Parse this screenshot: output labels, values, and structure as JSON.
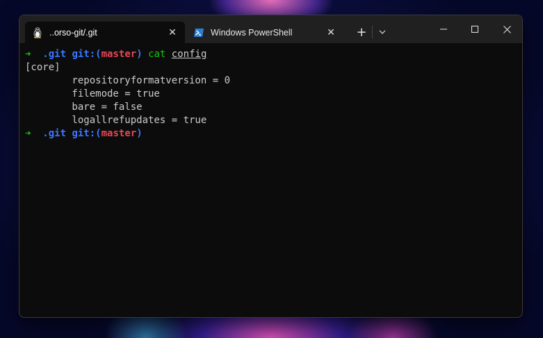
{
  "window": {
    "tabs": [
      {
        "title": "..orso-git/.git",
        "icon": "linux-penguin-icon",
        "active": true
      },
      {
        "title": "Windows PowerShell",
        "icon": "powershell-icon",
        "active": false
      }
    ],
    "new_tab_label": "+",
    "dropdown_label": "⌄"
  },
  "terminal": {
    "prompt": {
      "arrow": "➜",
      "dir": ".git",
      "git_prefix": "git:(",
      "branch": "master",
      "git_suffix": ")"
    },
    "command": "cat",
    "argument": "config",
    "output": [
      "[core]",
      "        repositoryformatversion = 0",
      "        filemode = true",
      "        bare = false",
      "        logallrefupdates = true"
    ]
  },
  "colors": {
    "terminal_bg": "#0c0c0c",
    "titlebar_bg": "#202020",
    "prompt_arrow": "#16c60c",
    "prompt_dir": "#3b78ff",
    "branch": "#e74856"
  }
}
